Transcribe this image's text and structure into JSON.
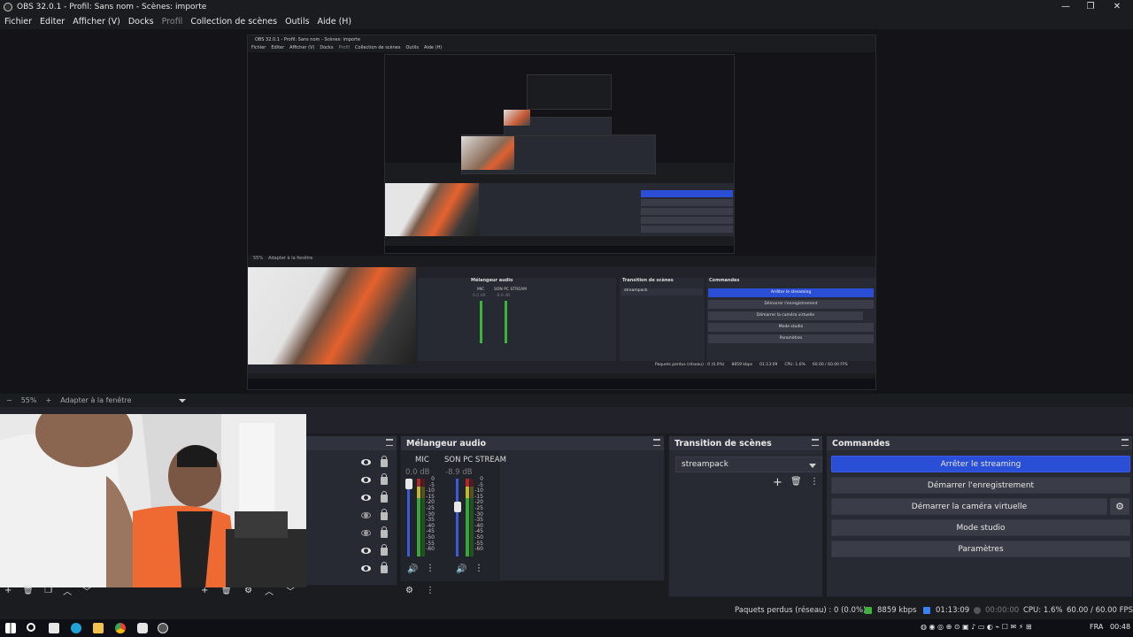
{
  "window": {
    "title": "OBS 32.0.1 - Profil: Sans nom - Scènes: importe",
    "minimize": "—",
    "restore": "❐",
    "close": "✕"
  },
  "menu": [
    "Fichier",
    "Editer",
    "Afficher (V)",
    "Docks",
    "Profil",
    "Collection de scènes",
    "Outils",
    "Aide (H)"
  ],
  "preview_bar": {
    "minus": "−",
    "zoom": "55%",
    "plus": "+",
    "fit": "Adapter à la fenêtre"
  },
  "nested": {
    "title": "OBS 32.0.1 - Profil: Sans nom - Scènes: importe",
    "menu": [
      "Fichier",
      "Editer",
      "Afficher (V)",
      "Docks",
      "Profil",
      "Collection de scènes",
      "Outils",
      "Aide (H)"
    ],
    "zoom": "55%",
    "fit": "Adapter à la fenêtre",
    "mixer_title": "Mélangeur audio",
    "transition_title": "Transition de scènes",
    "commands_title": "Commandes",
    "ch1": "MIC",
    "ch2": "SON PC STREAM",
    "db1": "0.0 dB",
    "db2": "-8.9 dB",
    "transition": "streampack",
    "buttons": [
      "Arrêter le streaming",
      "Démarrer l'enregistrement",
      "Démarrer la caméra virtuelle",
      "Mode studio",
      "Paramètres"
    ],
    "status": "Paquets perdus (réseau) : 0 (0.0%)",
    "bitrate": "8859 kbps",
    "time": "01:13:09",
    "cpu": "CPU: 1.6%",
    "fps": "60.00 / 60.00 FPS"
  },
  "mixer": {
    "title": "Mélangeur audio",
    "channels": [
      {
        "name": "MIC",
        "db": "0.0 dB",
        "level": 1.0
      },
      {
        "name": "SON PC STREAM",
        "db": "-8.9 dB",
        "level": 0.66
      }
    ],
    "scale": [
      "0",
      "-5",
      "-10",
      "-15",
      "-20",
      "-25",
      "-30",
      "-35",
      "-40",
      "-45",
      "-50",
      "-55",
      "-60"
    ]
  },
  "transition": {
    "title": "Transition de scènes",
    "selected": "streampack"
  },
  "commands": {
    "title": "Commandes",
    "stop_streaming": "Arrêter le streaming",
    "start_recording": "Démarrer l'enregistrement",
    "start_virtual_cam": "Démarrer la caméra virtuelle",
    "studio_mode": "Mode studio",
    "settings": "Paramètres"
  },
  "sources": {
    "visibility": [
      true,
      true,
      true,
      false,
      false,
      true,
      true
    ]
  },
  "status": {
    "dropped": "Paquets perdus (réseau) : 0 (0.0%)",
    "bitrate": "8859 kbps",
    "stream_time": "01:13:09",
    "rec_time": "00:00:00",
    "cpu": "CPU: 1.6%",
    "fps": "60.00 / 60.00 FPS"
  },
  "taskbar": {
    "lang": "FRA",
    "clock": "00:48"
  },
  "colors": {
    "accent": "#2b4ed6",
    "dock_bg": "#272a33",
    "bitrate_indicator": "#3cb43c"
  }
}
